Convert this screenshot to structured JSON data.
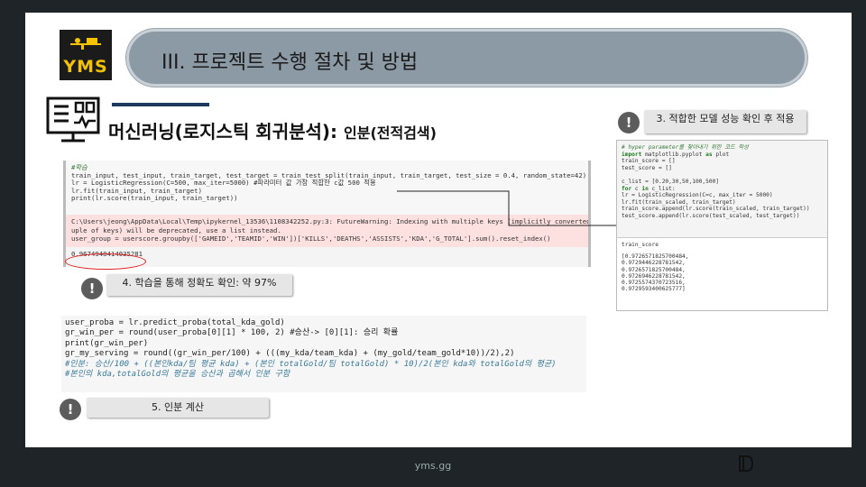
{
  "brand": {
    "logo_text": "YMS",
    "accent": "#f4c200"
  },
  "header": {
    "title": "III. 프로젝트 수행 절차 및 방법"
  },
  "slide": {
    "title": "머신러닝(로지스틱 회귀분석):",
    "subtitle": "인분(전적검색)"
  },
  "notes": [
    {
      "text": "3. 적합한 모델 성능 확인 후 적용"
    },
    {
      "text": "4. 학습을 통해 정확도 확인: 약 97%"
    },
    {
      "text": "5. 인분 계산"
    }
  ],
  "code1": {
    "lines": [
      "#학습",
      "train_input, test_input, train_target, test_target = train_test_split(train_input, train_target, test_size = 0.4, random_state=42)",
      "lr = LogisticRegression(C=500, max_iter=5000) #파라미터 값 가장 적합한 c값 500 적용",
      "lr.fit(train_input, train_target)",
      "print(lr.score(train_input, train_target))"
    ],
    "warning": [
      "C:\\Users\\jeong\\AppData\\Local\\Temp\\ipykernel_13536\\1108342252.py:3: FutureWarning: Indexing with multiple keys (implicitly converted to a t",
      "uple of keys) will be deprecated, use a list instead.",
      "  user_group = userscore.groupby(['GAMEID','TEAMID','WIN'])['KILLS','DEATHS','ASSISTS','KDA','G_TOTAL'].sum().reset_index()"
    ],
    "output": "0.9674948414035281"
  },
  "code2": {
    "lines": [
      "# hyper parameter를 찾아내기 위한 코드 작성",
      "import matplotlib.pyplot as plot",
      "train_score = []",
      "test_score = []",
      "",
      "c_list = [0.20,30,50,100,500]",
      "for c in c_list:",
      "    lr = LogisticRegression(C=c, max_iter = 5000)",
      "    lr.fit(train_scaled, train_target)",
      "    train_score.append(lr.score(train_scaled, train_target))",
      "    test_score.append(lr.score(test_scaled, test_target))"
    ],
    "var_label": "train_score",
    "values": [
      "[0.9726571825700484,",
      " 0.9729446228781542,",
      " 0.9726571825700484,",
      " 0.9726946228781542,",
      " 0.9725574370723516,",
      " 0.9729593400625777]"
    ]
  },
  "code3": {
    "lines": [
      "user_proba = lr.predict_proba(total_kda_gold)",
      "gr_win_per = round(user_proba[0][1] * 100, 2)  #승산-> [0][1]: 승리 확률",
      "print(gr_win_per)",
      "gr_my_serving = round((gr_win_per/100) + (((my_kda/team_kda) + (my_gold/team_gold*10))/2),2)",
      "#인분: 승산/100 + ((본인kda/팀 평균 kda) + (본인 totalGold/팀 totalGold) * 10)/2(본인 kda와 totalGold의 평균)",
      "#본인의 kda,totalGold의 평균을 승산과 곱해서 인분 구함"
    ]
  },
  "footer": {
    "site": "yms.gg"
  }
}
